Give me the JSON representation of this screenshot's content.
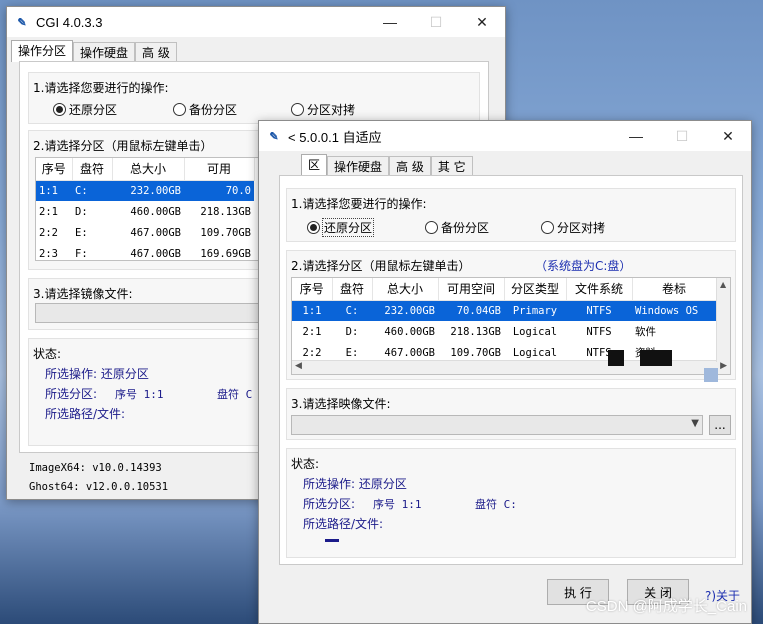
{
  "back_window": {
    "title": "CGI 4.0.3.3",
    "tabs": [
      "操作分区",
      "操作硬盘",
      "高 级"
    ],
    "section1_label": "1.请选择您要进行的操作:",
    "radio_restore": "还原分区",
    "radio_backup": "备份分区",
    "radio_copy": "分区对拷",
    "section2_label": "2.请选择分区（用鼠标左键单击）",
    "columns": [
      "序号",
      "盘符",
      "总大小",
      "可用"
    ],
    "rows": [
      [
        "1:1",
        "C:",
        "232.00GB",
        "70.0"
      ],
      [
        "2:1",
        "D:",
        "460.00GB",
        "218.13GB"
      ],
      [
        "2:2",
        "E:",
        "467.00GB",
        "109.70GB"
      ],
      [
        "2:3",
        "F:",
        "467.00GB",
        "169.69GB"
      ]
    ],
    "section3_label": "3.请选择镜像文件:",
    "status_label": "状态:",
    "status_op": "所选操作: 还原分区",
    "status_part_label": "所选分区:",
    "status_seq": "序号 1:1",
    "status_drive": "盘符 C",
    "status_path": "所选路径/文件:",
    "imagex": "ImageX64: v10.0.14393",
    "ghost": "Ghost64: v12.0.0.10531"
  },
  "front_window": {
    "title": "< 5.0.0.1 自适应",
    "tabs": [
      "区",
      "操作硬盘",
      "高 级",
      "其 它"
    ],
    "section1_label": "1.请选择您要进行的操作:",
    "radio_restore": "还原分区",
    "radio_backup": "备份分区",
    "radio_copy": "分区对拷",
    "section2_label": "2.请选择分区（用鼠标左键单击）",
    "system_disk": "（系统盘为C:盘）",
    "columns": [
      "序号",
      "盘符",
      "总大小",
      "可用空间",
      "分区类型",
      "文件系统",
      "卷标"
    ],
    "rows": [
      [
        "1:1",
        "C:",
        "232.00GB",
        "70.04GB",
        "Primary",
        "NTFS",
        "Windows OS"
      ],
      [
        "2:1",
        "D:",
        "460.00GB",
        "218.13GB",
        "Logical",
        "NTFS",
        "软件"
      ],
      [
        "2:2",
        "E:",
        "467.00GB",
        "109.70GB",
        "Logical",
        "NTFS",
        "资料"
      ]
    ],
    "section3_label": "3.请选择映像文件:",
    "browse_label": "...",
    "status_label": "状态:",
    "status_op": "所选操作: 还原分区",
    "status_part_label": "所选分区:",
    "status_seq": "序号 1:1",
    "status_drive": "盘符 C:",
    "status_path": "所选路径/文件:",
    "execute": "执 行",
    "close": "关 闭",
    "about": "?)关于"
  },
  "watermark": "CSDN @阿成学长_Cain",
  "colors": {
    "selection": "#0a64d8",
    "status_text": "#1b1b8a"
  }
}
